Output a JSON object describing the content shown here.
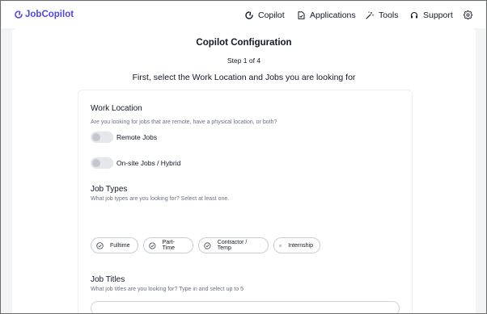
{
  "brand": {
    "name": "JobCopilot",
    "accent": "#4f46e5"
  },
  "nav": {
    "items": [
      {
        "label": "Copilot",
        "icon": "copilot-icon"
      },
      {
        "label": "Applications",
        "icon": "document-icon"
      },
      {
        "label": "Tools",
        "icon": "magic-wand-icon"
      },
      {
        "label": "Support",
        "icon": "headset-icon"
      }
    ],
    "settings_icon": "gear-icon"
  },
  "config": {
    "title": "Copilot Configuration",
    "step": "Step 1 of 4",
    "subtitle": "First, select the Work Location and Jobs you are looking for"
  },
  "work_location": {
    "title": "Work Location",
    "description": "Are you looking for jobs that are remote, have a physical location, or both?",
    "options": [
      {
        "label": "Remote Jobs",
        "enabled": false
      },
      {
        "label": "On-site Jobs / Hybrid",
        "enabled": false
      }
    ]
  },
  "job_types": {
    "title": "Job Types",
    "description": "What job types are you looking for? Select at least one.",
    "options": [
      "Fulltime",
      "Part-Time",
      "Contractor / Temp",
      "Internship"
    ]
  },
  "job_titles": {
    "title": "Job Titles",
    "description": "What job titles are you looking for? Type in and select up to 5",
    "input_value": "",
    "input_placeholder": ""
  }
}
